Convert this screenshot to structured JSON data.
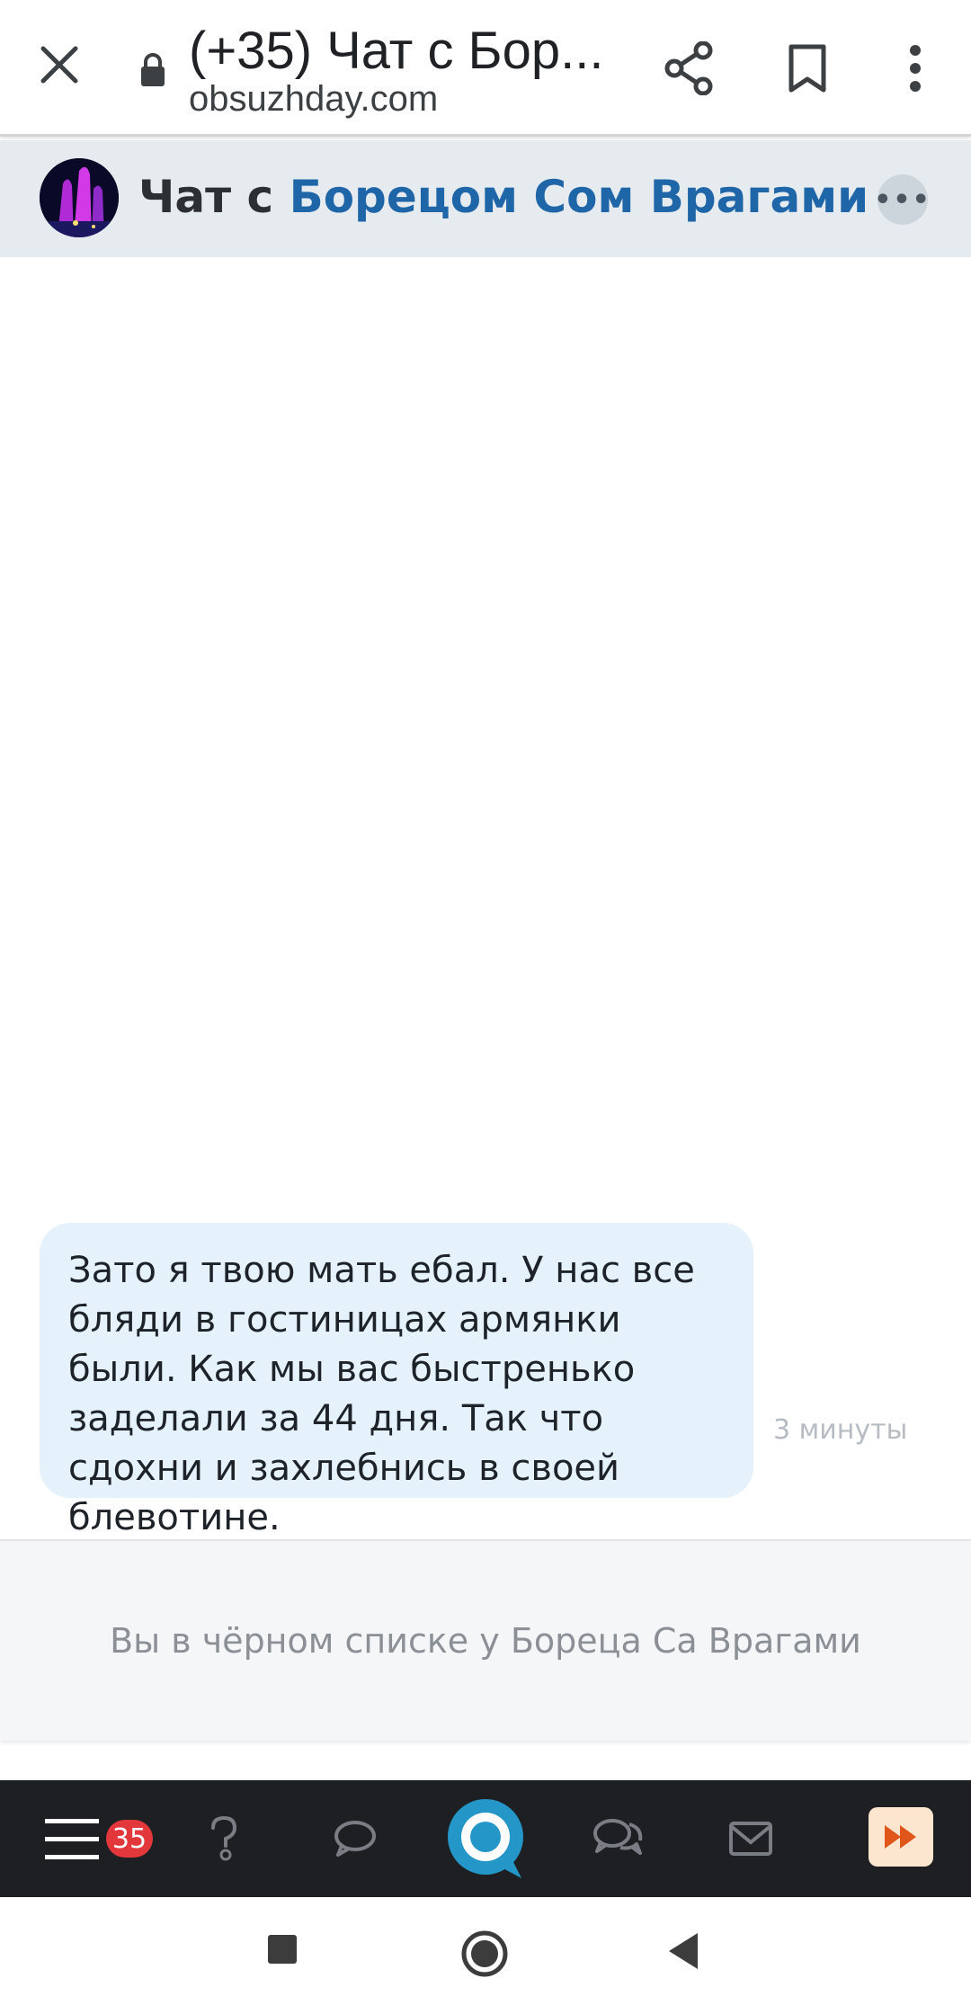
{
  "browser": {
    "tab_title": "(+35) Чат с Бор...",
    "domain": "obsuzhday.com",
    "icons": [
      "close-icon",
      "lock-icon",
      "share-icon",
      "bookmark-icon",
      "more-vert-icon"
    ]
  },
  "chat": {
    "title_prefix": "Чат с ",
    "title_name": "Борецом Сом Врагами",
    "more_label": "•••"
  },
  "messages": [
    {
      "text": "Зато я твою мать ебал. У нас все бляди в гостиницах армянки были. Как мы вас быстренько заделали за 44 дня. Так что сдохни и захлебнись в своей блевотине.",
      "time": "3 минуты"
    }
  ],
  "notice": {
    "blocked_text": "Вы в чёрном списке у Бореца Са Врагами"
  },
  "site_nav": {
    "badge_count": "35",
    "items": [
      "menu-icon",
      "question-icon",
      "comment-icon",
      "logo-icon",
      "chats-icon",
      "mail-icon",
      "fast-forward-icon"
    ],
    "accent": "#2496c8",
    "badge_color": "#e2383c"
  },
  "android_nav": {
    "items": [
      "recents-button",
      "home-button",
      "back-button"
    ]
  }
}
